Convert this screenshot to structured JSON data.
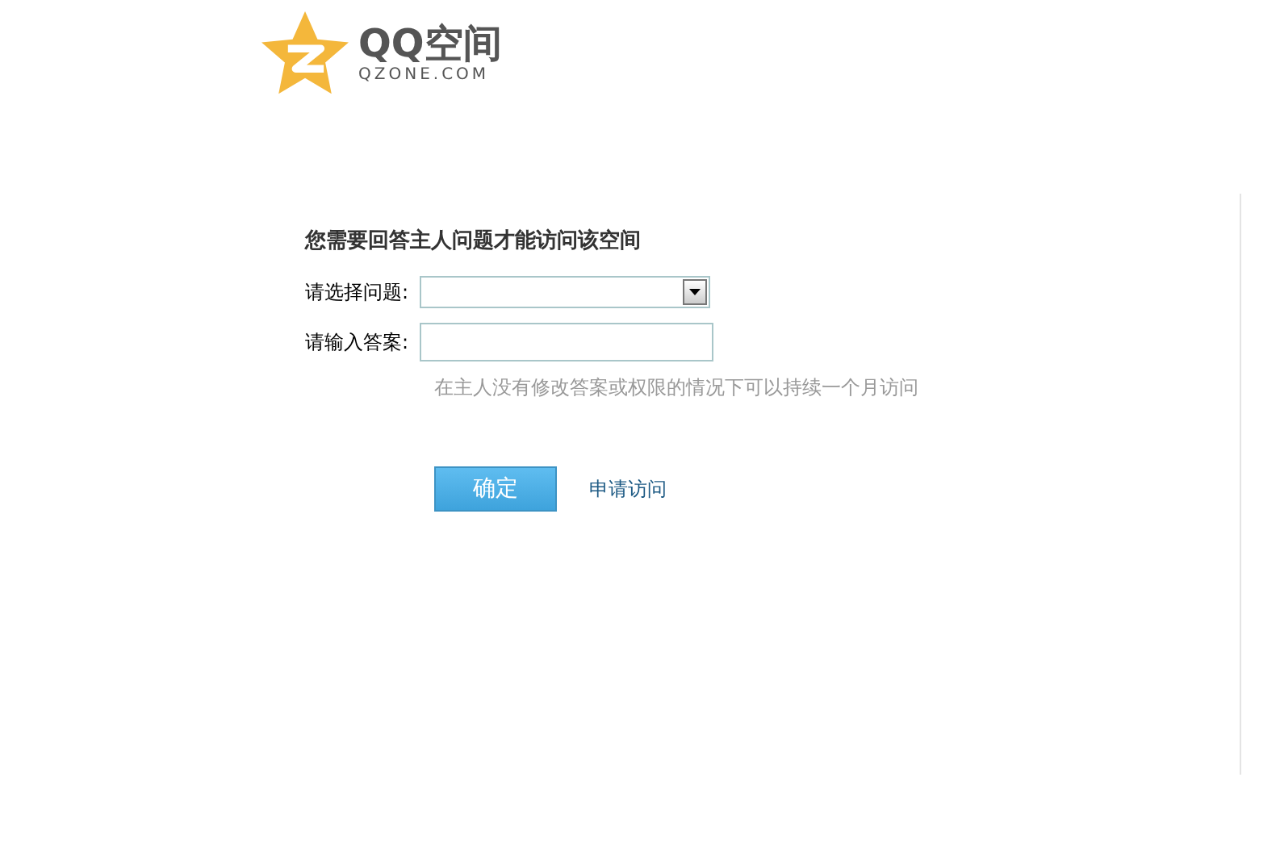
{
  "logo": {
    "title": "QQ空间",
    "subtitle": "QZONE.COM"
  },
  "form": {
    "heading": "您需要回答主人问题才能访问该空间",
    "question": {
      "label": "请选择问题:"
    },
    "answer": {
      "label": "请输入答案:"
    },
    "note": "在主人没有修改答案或权限的情况下可以持续一个月访问",
    "buttons": [
      {
        "label": "确定",
        "kind": "primary"
      },
      {
        "label": "申请访问",
        "kind": "link"
      }
    ]
  }
}
